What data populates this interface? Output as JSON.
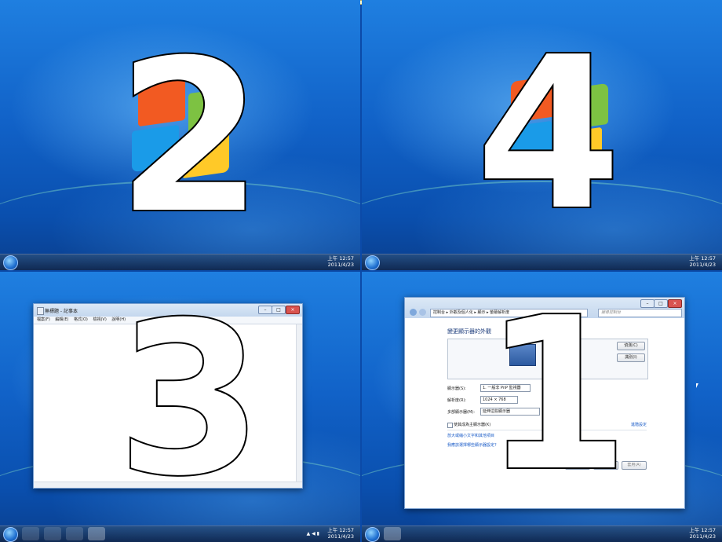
{
  "clock": {
    "time": "上午 12:57",
    "date": "2011/4/23"
  },
  "numbers": {
    "top_left": "2",
    "top_right": "4",
    "bottom_left": "3",
    "bottom_right": "1"
  },
  "notepad": {
    "title": "無標題 - 記事本",
    "menu": [
      "檔案(F)",
      "編輯(E)",
      "格式(O)",
      "檢視(V)",
      "說明(H)"
    ]
  },
  "display_settings": {
    "breadcrumb": [
      "控制台",
      "外觀及個人化",
      "顯示",
      "螢幕解析度"
    ],
    "search_placeholder": "搜尋控制台",
    "heading": "變更顯示器的外觀",
    "detect_button": "偵測(C)",
    "identify_button": "識別(I)",
    "display_label": "顯示器(S):",
    "display_value": "1. 一般非 PnP 監視器",
    "resolution_label": "解析度(R):",
    "resolution_value": "1024 × 768",
    "multi_label": "多部顯示器(M):",
    "multi_value": "延伸這些顯示器",
    "main_display_checkbox": "使其成為主顯示器(K)",
    "advanced_link": "進階設定",
    "link_text_size": "放大或縮小文字和其他項目",
    "link_which_settings": "我應該選擇哪些顯示器設定?",
    "ok_button": "確定",
    "cancel_button": "取消",
    "apply_button": "套用(A)"
  },
  "colors": {
    "accent": "#1162c8",
    "link": "#1a5cc8"
  }
}
